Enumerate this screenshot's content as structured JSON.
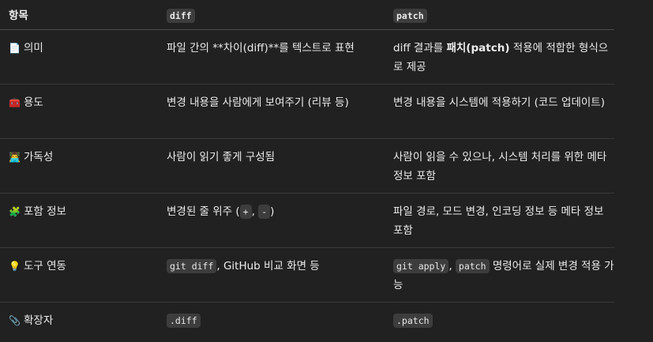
{
  "header": {
    "col1": "항목",
    "col2": "diff",
    "col3": "patch"
  },
  "rows": [
    {
      "icon": "📄",
      "icon_name": "document-icon",
      "label": "의미",
      "diff_a": "파일 간의 **차이(diff)**를 텍스트로 표현",
      "patch_a": "diff 결과를 ",
      "patch_b": "패치(patch)",
      "patch_c": " 적용에 적합한 형식으로 제공"
    },
    {
      "icon": "🧰",
      "icon_name": "toolbox-icon",
      "label": "용도",
      "diff_a": "변경 내용을 사람에게 보여주기 (리뷰 등)",
      "patch_a": "변경 내용을 시스템에 적용하기 (코드 업데이트)"
    },
    {
      "icon": "👨‍💻",
      "icon_name": "person-computer-icon",
      "label": "가독성",
      "diff_a": "사람이 읽기 좋게 구성됨",
      "patch_a": "사람이 읽을 수 있으나, 시스템 처리를 위한 메타 정보 포함"
    },
    {
      "icon": "🧩",
      "icon_name": "puzzle-icon",
      "label": "포함 정보",
      "diff_a": "변경된 줄 위주 (",
      "diff_code1": "+",
      "diff_b": ", ",
      "diff_code2": "-",
      "diff_c": ")",
      "patch_a": "파일 경로, 모드 변경, 인코딩 정보 등 메타 정보 포함"
    },
    {
      "icon": "💡",
      "icon_name": "lightbulb-icon",
      "label": "도구 연동",
      "diff_code1": "git diff",
      "diff_a": ", GitHub 비교 화면 등",
      "patch_code1": "git apply",
      "patch_b": ", ",
      "patch_code2": "patch",
      "patch_a": " 명령어로 실제 변경 적용 가능"
    },
    {
      "icon": "📎",
      "icon_name": "paperclip-icon",
      "label": "확장자",
      "diff_code1": ".diff",
      "patch_code1": ".patch"
    }
  ]
}
